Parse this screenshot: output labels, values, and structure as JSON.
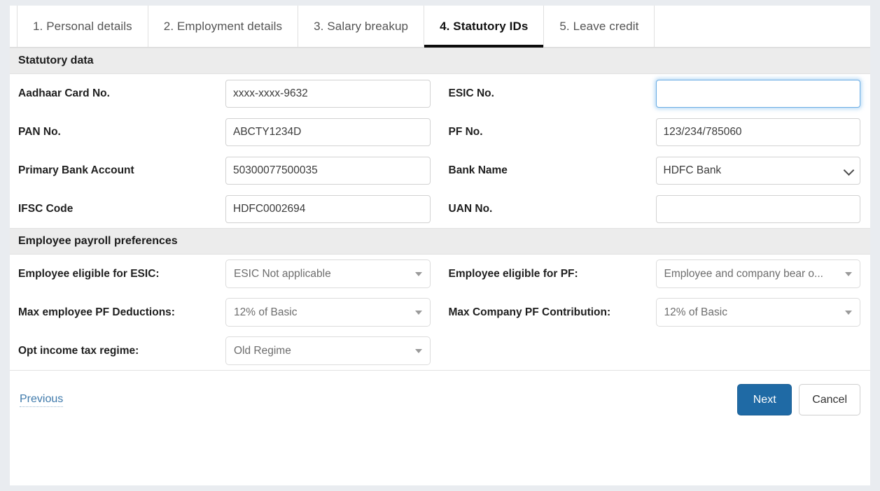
{
  "tabs": [
    {
      "label": "1. Personal details",
      "active": false
    },
    {
      "label": "2. Employment details",
      "active": false
    },
    {
      "label": "3. Salary breakup",
      "active": false
    },
    {
      "label": "4. Statutory IDs",
      "active": true
    },
    {
      "label": "5. Leave credit",
      "active": false
    }
  ],
  "sections": {
    "statutory": {
      "title": "Statutory data",
      "fields": {
        "aadhaar": {
          "label": "Aadhaar Card No.",
          "value": "xxxx-xxxx-9632",
          "placeholder": ""
        },
        "esic": {
          "label": "ESIC No.",
          "value": "",
          "placeholder": ""
        },
        "pan": {
          "label": "PAN No.",
          "value": "ABCTY1234D",
          "placeholder": ""
        },
        "pf": {
          "label": "PF No.",
          "value": "123/234/785060",
          "placeholder": ""
        },
        "bank_account": {
          "label": "Primary Bank Account",
          "value": "50300077500035",
          "placeholder": ""
        },
        "bank_name": {
          "label": "Bank Name",
          "value": "HDFC Bank",
          "options": [
            "HDFC Bank"
          ]
        },
        "ifsc": {
          "label": "IFSC Code",
          "value": "HDFC0002694",
          "placeholder": ""
        },
        "uan": {
          "label": "UAN No.",
          "value": "",
          "placeholder": ""
        }
      }
    },
    "preferences": {
      "title": "Employee payroll preferences",
      "fields": {
        "esic_eligible": {
          "label": "Employee eligible for ESIC:",
          "value": "ESIC Not applicable"
        },
        "pf_eligible": {
          "label": "Employee eligible for PF:",
          "value": "Employee and company bear o..."
        },
        "max_employee_pf": {
          "label": "Max employee PF Deductions:",
          "value": "12% of Basic"
        },
        "max_company_pf": {
          "label": "Max Company PF Contribution:",
          "value": "12% of Basic"
        },
        "tax_regime": {
          "label": "Opt income tax regime:",
          "value": "Old Regime"
        }
      }
    }
  },
  "footer": {
    "previous_label": "Previous",
    "next_label": "Next",
    "cancel_label": "Cancel"
  },
  "colors": {
    "primary_button": "#1f6aa5",
    "link": "#3f7aab",
    "focus_border": "#6aace4",
    "section_header_bg": "#ececec",
    "page_bg": "#e9ecf0"
  }
}
